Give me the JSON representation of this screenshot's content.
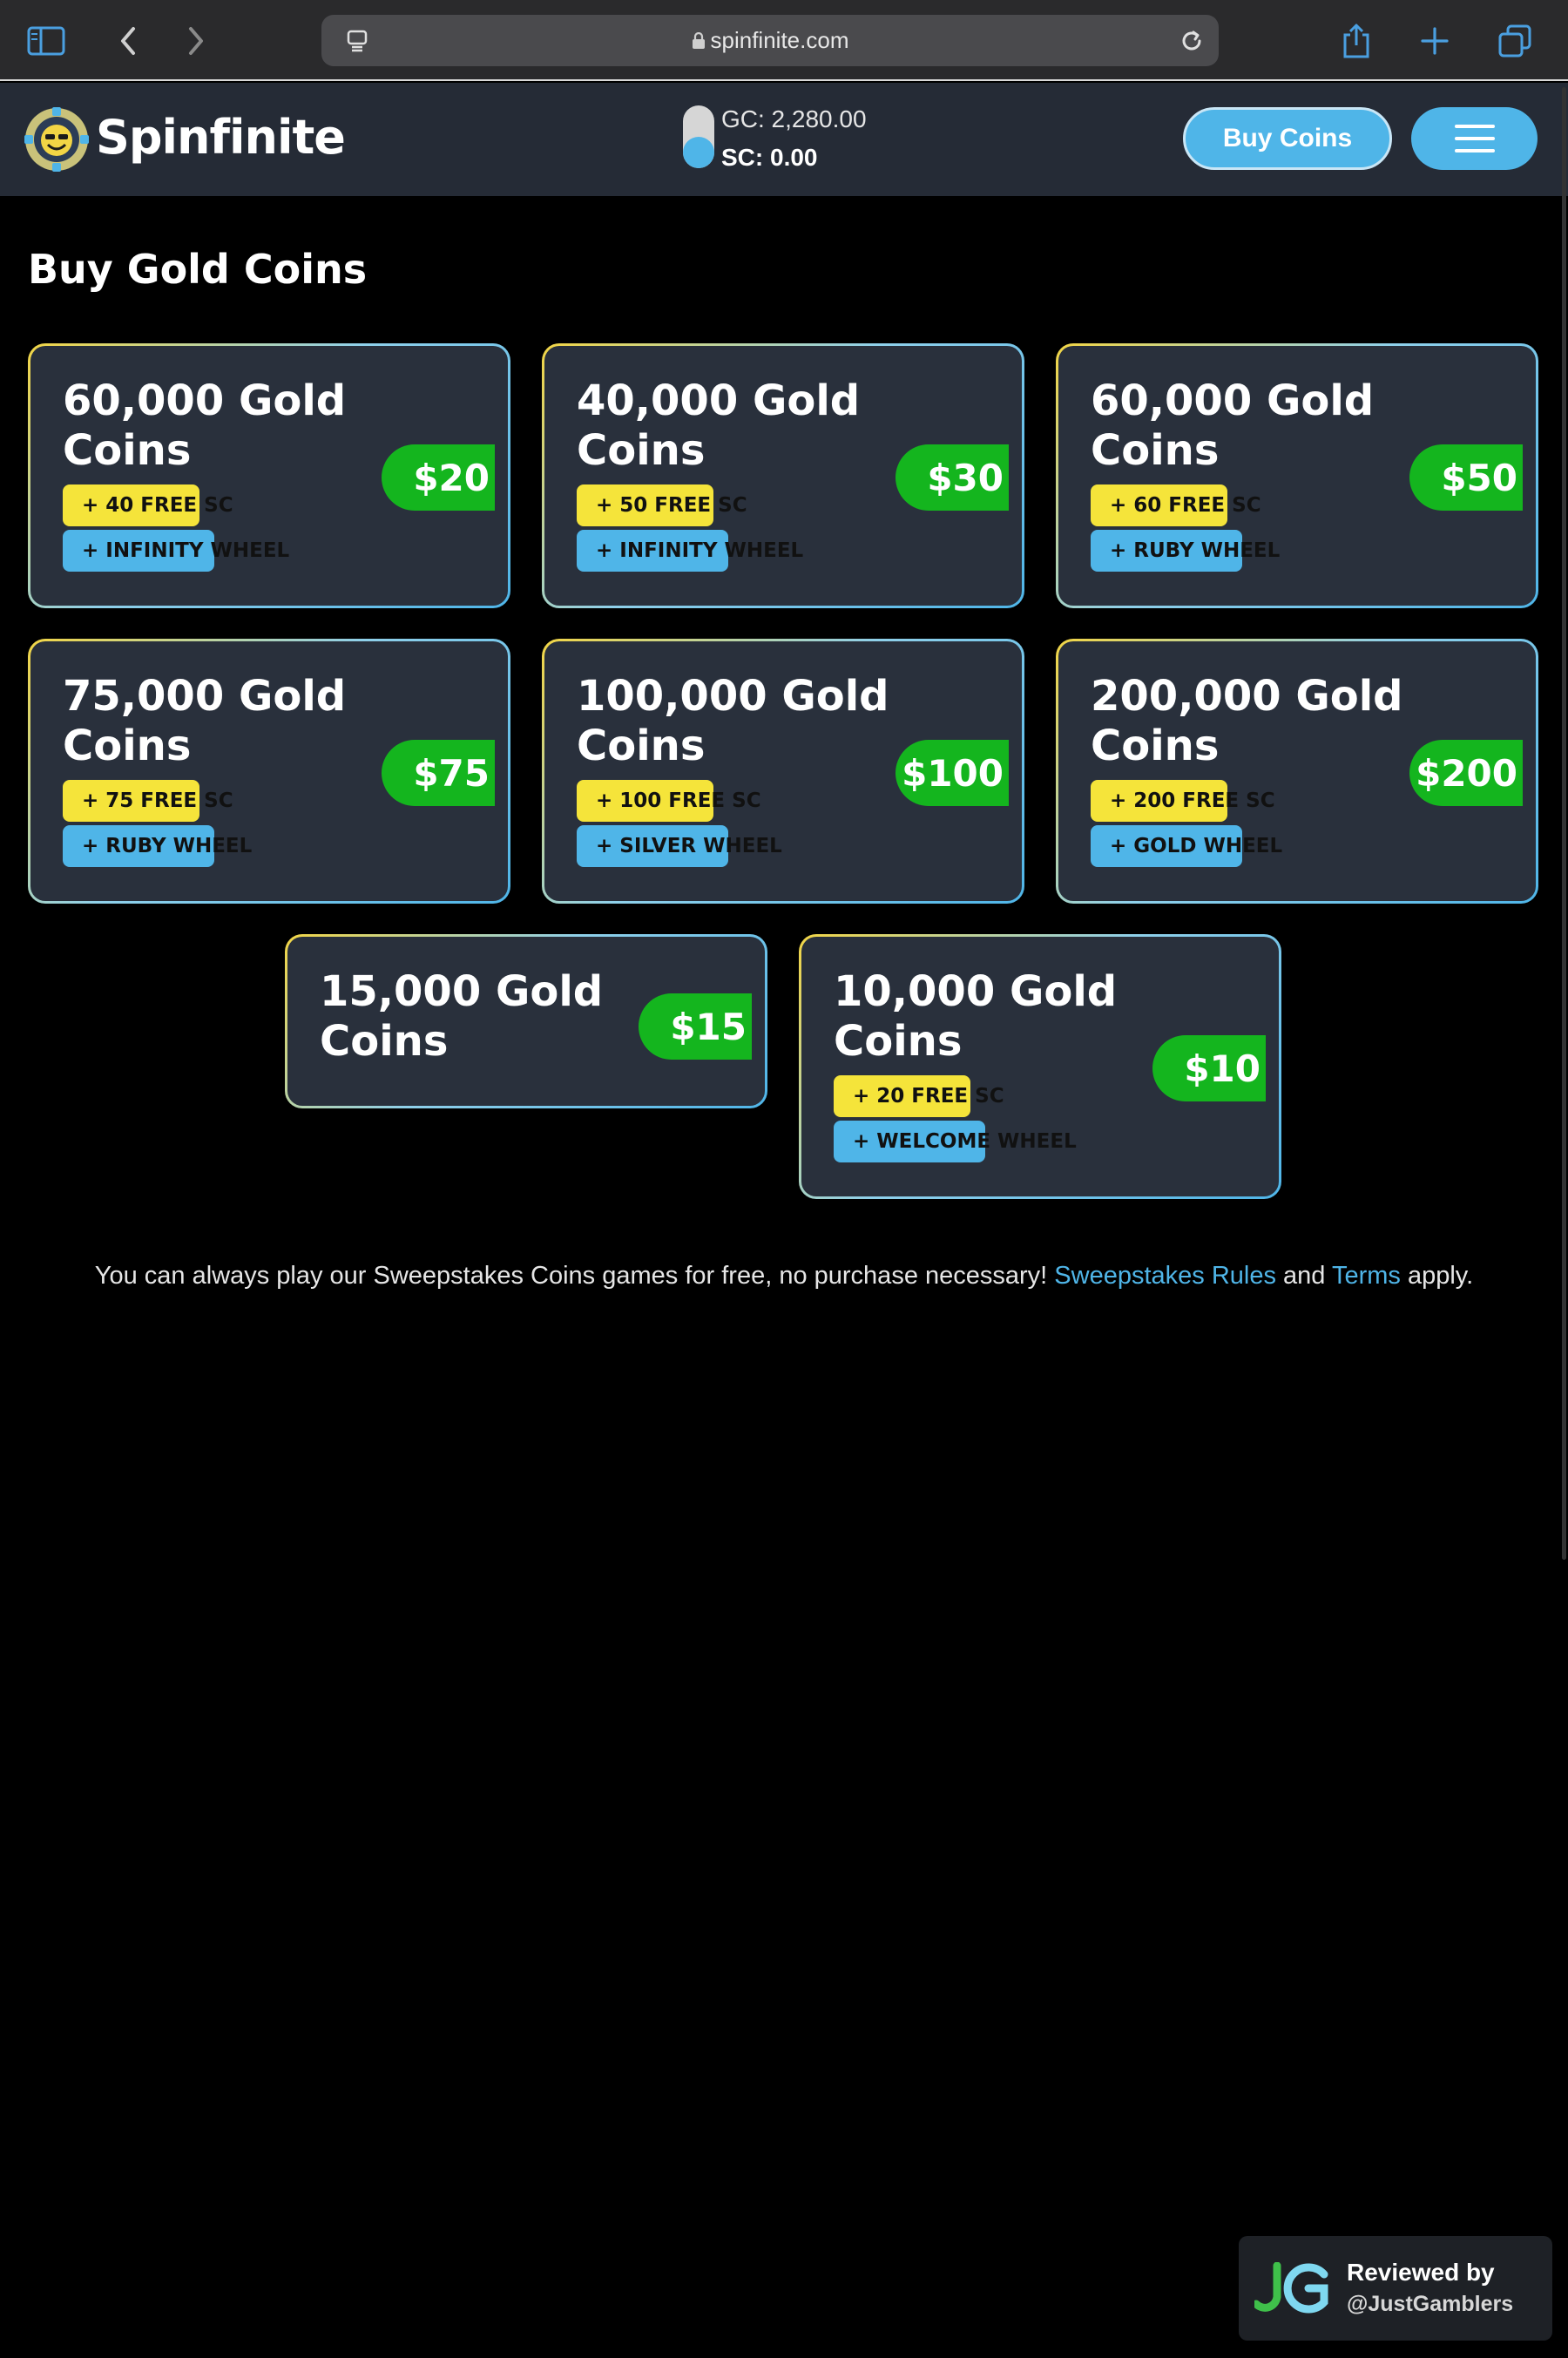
{
  "browser": {
    "url": "spinfinite.com",
    "icons": [
      "sidebar-icon",
      "back-icon",
      "forward-icon",
      "page-menu-icon",
      "lock-icon",
      "reload-icon",
      "share-icon",
      "new-tab-icon",
      "tabs-icon"
    ]
  },
  "header": {
    "brand": "Spinfinite",
    "gc_balance": "GC: 2,280.00",
    "sc_balance": "SC: 0.00",
    "buy_label": "Buy Coins",
    "menu_icon": "hamburger-menu-icon"
  },
  "page": {
    "title": "Buy Gold Coins"
  },
  "packages": [
    {
      "title": "60,000 Gold Coins",
      "price": "$20",
      "sc_bonus": "+ 40 FREE SC",
      "wheel_bonus": "+ INFINITY WHEEL"
    },
    {
      "title": "40,000 Gold Coins",
      "price": "$30",
      "sc_bonus": "+ 50 FREE SC",
      "wheel_bonus": "+ INFINITY WHEEL"
    },
    {
      "title": "60,000 Gold Coins",
      "price": "$50",
      "sc_bonus": "+ 60 FREE SC",
      "wheel_bonus": "+ RUBY WHEEL"
    },
    {
      "title": "75,000 Gold Coins",
      "price": "$75",
      "sc_bonus": "+ 75 FREE SC",
      "wheel_bonus": "+ RUBY WHEEL"
    },
    {
      "title": "100,000 Gold Coins",
      "price": "$100",
      "sc_bonus": "+ 100 FREE SC",
      "wheel_bonus": "+ SILVER WHEEL"
    },
    {
      "title": "200,000 Gold Coins",
      "price": "$200",
      "sc_bonus": "+ 200 FREE SC",
      "wheel_bonus": "+ GOLD WHEEL"
    },
    {
      "title": "15,000 Gold Coins",
      "price": "$15"
    },
    {
      "title": "10,000 Gold Coins",
      "price": "$10",
      "sc_bonus": "+ 20 FREE SC",
      "wheel_bonus": "+ WELCOME WHEEL"
    }
  ],
  "footer": {
    "text_before": "You can always play our Sweepstakes Coins games for free, no purchase necessary! ",
    "rules_link": "Sweepstakes Rules",
    "text_and": " and ",
    "terms_link": "Terms",
    "text_after": " apply."
  },
  "review": {
    "logo": "JG",
    "title": "Reviewed by",
    "handle": "@JustGamblers"
  },
  "colors": {
    "accent_blue": "#4fb5e8",
    "price_green": "#14b51e",
    "badge_yellow": "#f5e43a",
    "card_bg": "#29303c",
    "header_bg": "#252b36"
  }
}
